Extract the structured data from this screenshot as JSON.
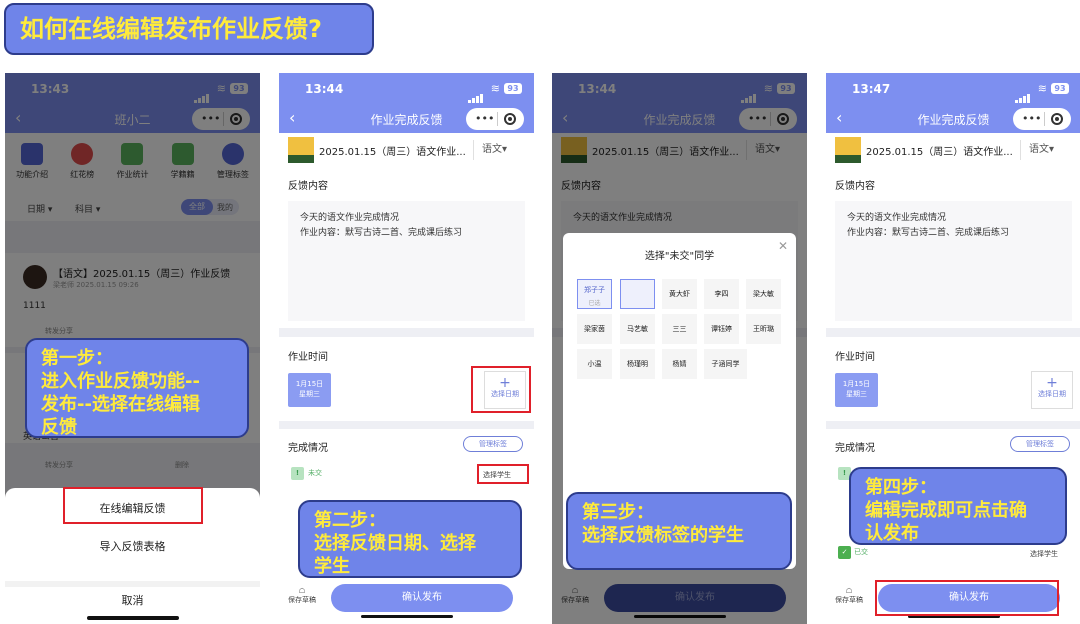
{
  "banner": {
    "title": "如何在线编辑发布作业反馈?"
  },
  "phone1": {
    "time": "13:43",
    "battery": "93",
    "nav_title": "班小二",
    "icons": [
      {
        "label": "功能介绍",
        "icon": "bookmark-icon",
        "color": "#5567d6"
      },
      {
        "label": "红花榜",
        "icon": "flower-icon",
        "color": "#e14c4c"
      },
      {
        "label": "作业统计",
        "icon": "bar-chart-icon",
        "color": "#5ab45e"
      },
      {
        "label": "学籍籍",
        "icon": "id-icon",
        "color": "#5ab45e"
      },
      {
        "label": "管理标签",
        "icon": "gear-icon",
        "color": "#5567d6"
      }
    ],
    "filter_date": "日期 ▾",
    "filter_subject": "科目 ▾",
    "toggle_on": "全部",
    "toggle_off": "我的",
    "card_title": "【语文】2025.01.15（周三）作业反馈",
    "card_sub": "梁老师 2025.01.15 09:26",
    "card_num": "1111",
    "share_text": "转发分享",
    "english_text": "英语公告",
    "action1": "转发分享",
    "action2": "删除",
    "sheet": {
      "item1": "在线编辑反馈",
      "item2": "导入反馈表格",
      "cancel": "取消"
    }
  },
  "phone2": {
    "time": "13:44",
    "battery": "93",
    "nav_title": "作业完成反馈",
    "hw_title": "2025.01.15（周三）语文作业...",
    "hw_subject": "语文▾",
    "feedback_label": "反馈内容",
    "feedback_text_1": "今天的语文作业完成情况",
    "feedback_text_2": "作业内容：默写古诗二首、完成课后练习",
    "time_label": "作业时间",
    "date_day": "1月15日",
    "date_week": "星期三",
    "add_date": "选择日期",
    "status_label": "完成情况",
    "tag_btn": "管理标签",
    "pending": "未交",
    "select_students": "选择学生",
    "draft": "保存草稿",
    "publish": "确认发布"
  },
  "phone3": {
    "time": "13:44",
    "battery": "93",
    "nav_title": "作业完成反馈",
    "hw_title": "2025.01.15（周三）语文作业...",
    "hw_subject": "语文▾",
    "feedback_label": "反馈内容",
    "feedback_text_1": "今天的语文作业完成情况",
    "modal_title": "选择\"未交\"同学",
    "students": [
      "郑子子",
      "",
      "黄大虾",
      "李四",
      "梁大敏",
      "梁家茵",
      "马艺敏",
      "三三",
      "谭钰婷",
      "王昕璐",
      "小温",
      "杨瑾明",
      "杨婧",
      "子涵同学"
    ],
    "draft": "保存草稿",
    "publish": "确认发布"
  },
  "phone4": {
    "time": "13:47",
    "battery": "93",
    "nav_title": "作业完成反馈",
    "hw_title": "2025.01.15（周三）语文作业...",
    "hw_subject": "语文▾",
    "feedback_label": "反馈内容",
    "feedback_text_1": "今天的语文作业完成情况",
    "feedback_text_2": "作业内容：默写古诗二首、完成课后练习",
    "time_label": "作业时间",
    "date_day": "1月15日",
    "date_week": "星期三",
    "add_date": "选择日期",
    "status_label": "完成情况",
    "tag_btn": "管理标签",
    "done": "已交",
    "select_students": "选择学生",
    "draft": "保存草稿",
    "publish": "确认发布"
  },
  "steps": {
    "step1": "第一步：\n进入作业反馈功能--\n发布--选择在线编辑\n反馈",
    "step2": "第二步：\n选择反馈日期、选择\n学生",
    "step3": "第三步：\n选择反馈标签的学生",
    "step4": "第四步：\n编辑完成即可点击确\n认发布"
  }
}
